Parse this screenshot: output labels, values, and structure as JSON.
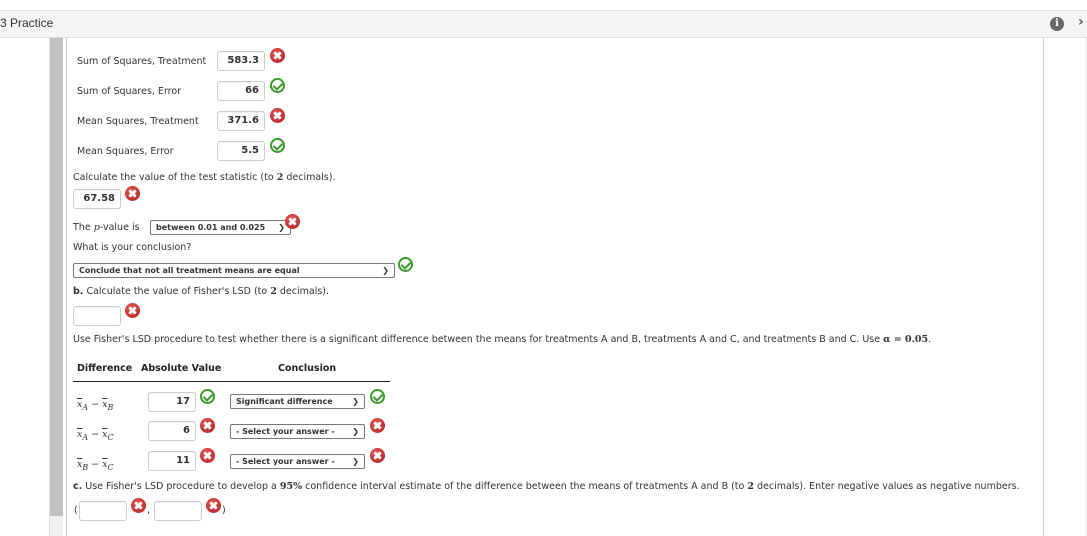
{
  "header": {
    "title": "3 Practice",
    "info_icon": "info-icon",
    "next_icon": "chevron-right-icon"
  },
  "anova": {
    "rows": [
      {
        "label": "Sum of Squares, Treatment",
        "value": "583.3",
        "status": "incorrect"
      },
      {
        "label": "Sum of Squares, Error",
        "value": "66",
        "status": "correct"
      },
      {
        "label": "Mean Squares, Treatment",
        "value": "371.6",
        "status": "incorrect"
      },
      {
        "label": "Mean Squares, Error",
        "value": "5.5",
        "status": "correct"
      }
    ]
  },
  "test_stat": {
    "prompt_pre": "Calculate the value of the test statistic (to ",
    "prompt_num": "2",
    "prompt_post": " decimals).",
    "value": "67.58",
    "status": "incorrect"
  },
  "pvalue": {
    "prefix": "The ",
    "p": "p",
    "suffix": "-value is",
    "selected": "between 0.01 and 0.025",
    "status": "incorrect"
  },
  "conclusion": {
    "question": "What is your conclusion?",
    "selected": "Conclude that not all treatment means are equal",
    "status": "correct"
  },
  "part_b": {
    "letter": "b.",
    "prompt_pre": " Calculate the value of Fisher's LSD (to ",
    "prompt_num": "2",
    "prompt_post": " decimals).",
    "value": "",
    "status": "incorrect",
    "instruction": "Use Fisher's LSD procedure to test whether there is a significant difference between the means for treatments A and B, treatments A and C, and treatments B and C. Use ",
    "alpha": "α = 0.05",
    "instruction_end": "."
  },
  "lsd_table": {
    "headers": [
      "Difference",
      "Absolute Value",
      "Conclusion"
    ],
    "rows": [
      {
        "diff": "x̄A − x̄B",
        "diff_a": "A",
        "diff_b": "B",
        "value": "17",
        "value_status": "correct",
        "conclusion": "Significant difference",
        "conclusion_status": "correct"
      },
      {
        "diff": "x̄A − x̄C",
        "diff_a": "A",
        "diff_b": "C",
        "value": "6",
        "value_status": "incorrect",
        "conclusion": "- Select your answer -",
        "conclusion_status": "incorrect"
      },
      {
        "diff": "x̄B − x̄C",
        "diff_a": "B",
        "diff_b": "C",
        "value": "11",
        "value_status": "incorrect",
        "conclusion": "- Select your answer -",
        "conclusion_status": "incorrect"
      }
    ]
  },
  "part_c": {
    "letter": "c.",
    "prompt_pre": " Use Fisher's LSD procedure to develop a ",
    "pct": "95%",
    "prompt_mid": " confidence interval estimate of the difference between the means of treatments A and B (to ",
    "prompt_num": "2",
    "prompt_post": " decimals). Enter negative values as negative numbers.",
    "open": "(",
    "comma": ",",
    "close": ")",
    "lower": "",
    "upper": "",
    "lower_status": "incorrect",
    "upper_status": "incorrect"
  }
}
